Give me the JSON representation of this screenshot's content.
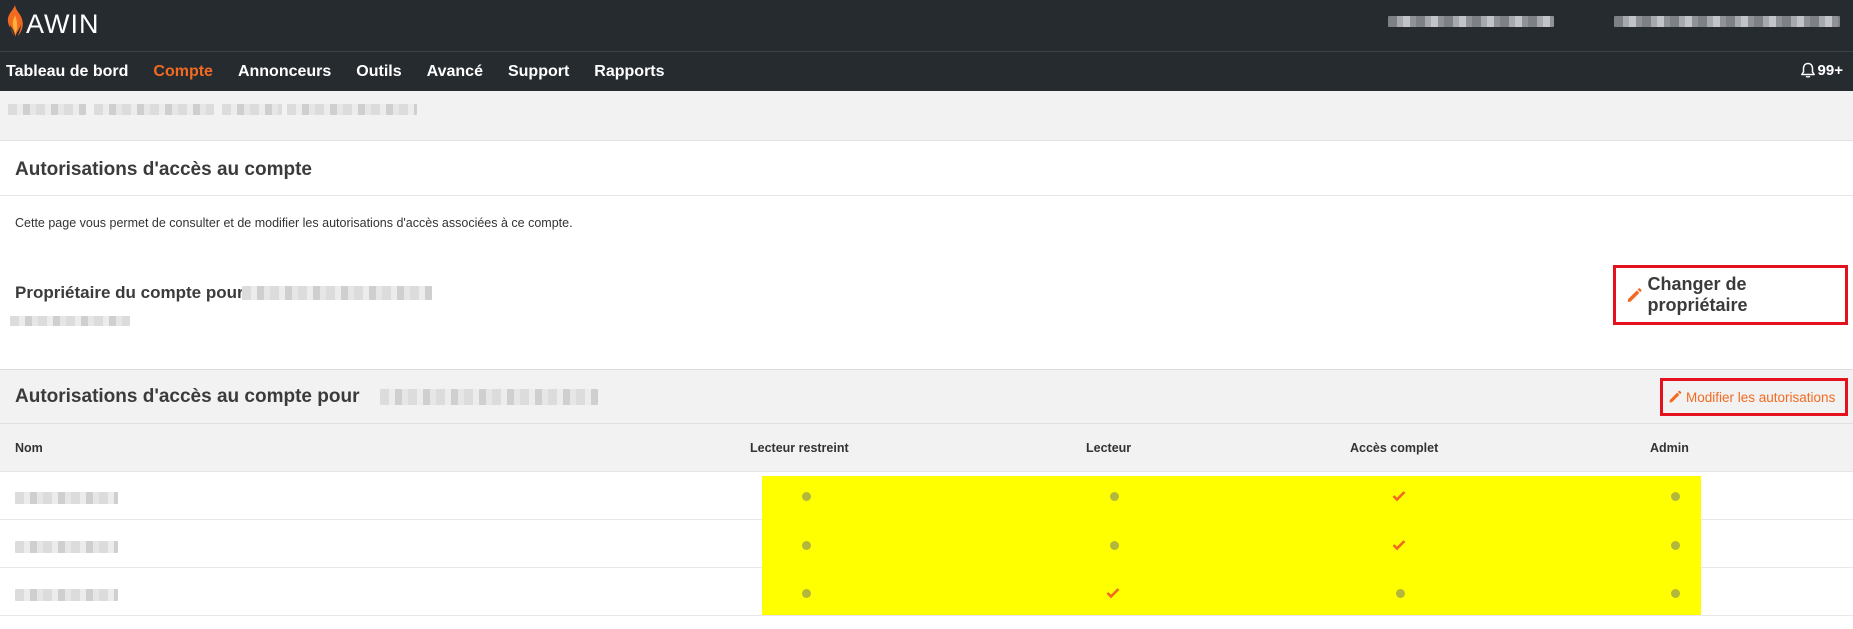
{
  "header": {
    "logo_text": "AWIN"
  },
  "nav": {
    "items": [
      {
        "label": "Tableau de bord",
        "active": false
      },
      {
        "label": "Compte",
        "active": true
      },
      {
        "label": "Annonceurs",
        "active": false
      },
      {
        "label": "Outils",
        "active": false
      },
      {
        "label": "Avancé",
        "active": false
      },
      {
        "label": "Support",
        "active": false
      },
      {
        "label": "Rapports",
        "active": false
      }
    ],
    "notifications": "99+"
  },
  "page": {
    "title": "Autorisations d'accès au compte",
    "description": "Cette page vous permet de consulter et de modifier les autorisations d'accès associées à ce compte.",
    "owner_label": "Propriétaire du compte pour",
    "change_owner_button": "Changer de propriétaire"
  },
  "permissions": {
    "title": "Autorisations d'accès au compte pour",
    "modify_button": "Modifier les autorisations",
    "columns": [
      "Nom",
      "Lecteur restreint",
      "Lecteur",
      "Accès complet",
      "Admin"
    ],
    "rows": [
      {
        "level": "Accès complet"
      },
      {
        "level": "Accès complet"
      },
      {
        "level": "Lecteur"
      }
    ]
  },
  "colors": {
    "accent": "#f26a21",
    "header_bg": "#262b30",
    "highlight_yellow": "#ffff00",
    "annotation_red": "#e3121e",
    "dot_olive": "#b3b73c"
  }
}
